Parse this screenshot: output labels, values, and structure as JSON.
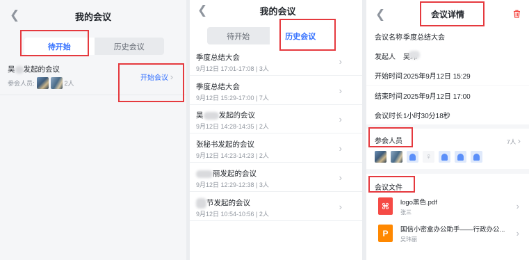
{
  "panel1": {
    "title": "我的会议",
    "tabs": [
      "待开始",
      "历史会议"
    ],
    "meeting": {
      "title_prefix": "吴",
      "title_suffix": "发起的会议",
      "participants_label": "参会人员:",
      "count": "2人",
      "start_button": "开始会议"
    }
  },
  "panel2": {
    "title": "我的会议",
    "tabs": [
      "待开始",
      "历史会议"
    ],
    "meetings": [
      {
        "title": "季度总结大会",
        "date": "9月12日 17:01-17:08",
        "count": "3人"
      },
      {
        "title": "季度总结大会",
        "date": "9月12日 15:29-17:00",
        "count": "7人"
      },
      {
        "title_prefix": "吴",
        "title_suffix": "发起的会议",
        "date": "9月12日 14:28-14:35",
        "count": "2人"
      },
      {
        "title": "张秘书发起的会议",
        "date": "9月12日 14:23-14:23",
        "count": "2人"
      },
      {
        "title_prefix": "",
        "title_suffix": "丽发起的会议",
        "date": "9月12日 12:29-12:38",
        "count": "3人"
      },
      {
        "title_prefix": "",
        "title_suffix": "节发起的会议",
        "date": "9月12日 10:54-10:56",
        "count": "2人"
      }
    ]
  },
  "panel3": {
    "title": "会议详情",
    "details": [
      {
        "label": "会议名称",
        "value": "季度总结大会"
      },
      {
        "label": "发起人",
        "value": "吴玮"
      },
      {
        "label": "开始时间",
        "value": "2025年9月12日 15:29"
      },
      {
        "label": "结束时间",
        "value": "2025年9月12日 17:00"
      },
      {
        "label": "会议时长",
        "value": "1小时30分18秒"
      }
    ],
    "participants_title": "参会人员",
    "participants_count": "7人",
    "files_title": "会议文件",
    "files": [
      {
        "icon": "pdf-icon",
        "name": "logo黑色.pdf",
        "owner": "张三"
      },
      {
        "icon": "ppt-icon",
        "name": "国信小密盒办公助手——行政办公...",
        "owner": "吴玮丽"
      }
    ]
  },
  "colors": {
    "accent": "#3370ff",
    "annotation_red": "#e5393e",
    "delete_red": "#f54a45",
    "pdf_red": "#f54a45",
    "ppt_orange": "#ff8800"
  }
}
